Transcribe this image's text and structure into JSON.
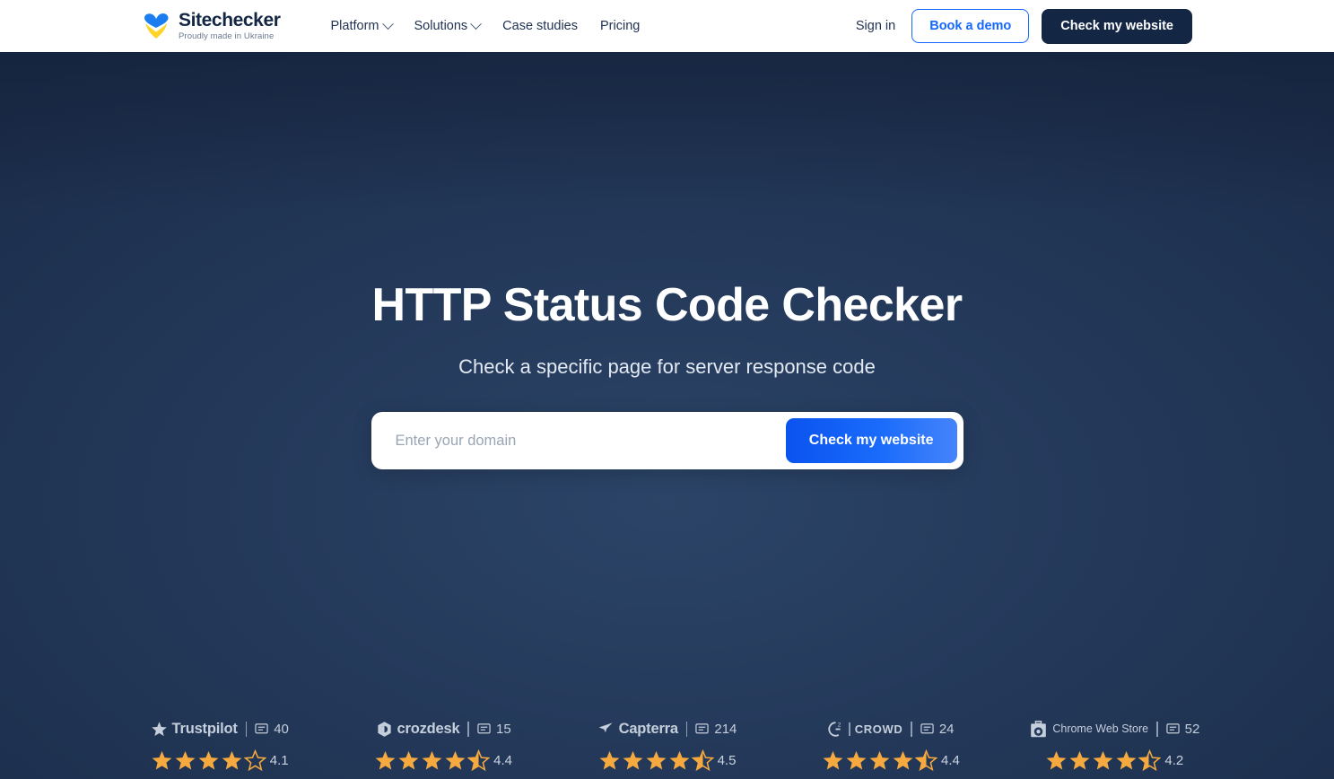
{
  "header": {
    "logo": {
      "name": "Sitechecker",
      "tagline": "Proudly made in Ukraine"
    },
    "nav": [
      {
        "label": "Platform",
        "has_dropdown": true
      },
      {
        "label": "Solutions",
        "has_dropdown": true
      },
      {
        "label": "Case studies",
        "has_dropdown": false
      },
      {
        "label": "Pricing",
        "has_dropdown": false
      }
    ],
    "signin_label": "Sign in",
    "demo_label": "Book a demo",
    "cta_label": "Check my website"
  },
  "hero": {
    "title": "HTTP Status Code Checker",
    "subtitle": "Check a specific page for server response code",
    "search_placeholder": "Enter your domain",
    "search_value": "",
    "search_button_label": "Check my website"
  },
  "reviews": [
    {
      "brand": "Trustpilot",
      "icon": "trustpilot-star-icon",
      "count": "40",
      "rating": "4.1",
      "full_stars": 4,
      "half_star": false
    },
    {
      "brand": "crozdesk",
      "icon": "crozdesk-icon",
      "count": "15",
      "rating": "4.4",
      "full_stars": 4,
      "half_star": true
    },
    {
      "brand": "Capterra",
      "icon": "capterra-icon",
      "count": "214",
      "rating": "4.5",
      "full_stars": 4,
      "half_star": true
    },
    {
      "brand": "CROWD",
      "icon": "g2-crowd-icon",
      "count": "24",
      "rating": "4.4",
      "full_stars": 4,
      "half_star": true
    },
    {
      "brand": "Chrome Web Store",
      "icon": "chrome-web-store-icon",
      "count": "52",
      "rating": "4.2",
      "full_stars": 4,
      "half_star": true
    }
  ],
  "colors": {
    "brand_blue": "#1467ff",
    "dark_navy": "#132744",
    "hero_bg": "#24395a",
    "star_gold": "#f5a93f",
    "logo_blue": "#1c7df0",
    "logo_yellow": "#ffd429"
  }
}
